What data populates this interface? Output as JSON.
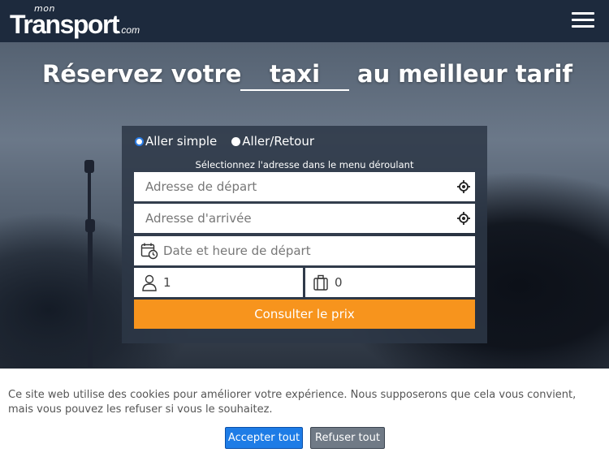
{
  "header": {
    "logo_mon": "mon",
    "logo_main": "Transport",
    "logo_com": ".com",
    "menu_icon": "hamburger-menu-icon"
  },
  "hero": {
    "headline_pre": "Réservez votre",
    "headline_word": "taxi",
    "headline_post": "au meilleur tarif"
  },
  "form": {
    "trip_types": [
      {
        "label": "Aller simple",
        "selected": true
      },
      {
        "label": "Aller/Retour",
        "selected": false
      }
    ],
    "hint": "Sélectionnez l'adresse dans le menu déroulant",
    "departure_placeholder": "Adresse de départ",
    "arrival_placeholder": "Adresse d'arrivée",
    "date_placeholder": "Date et heure de départ",
    "passengers": "1",
    "luggage": "0",
    "submit_label": "Consulter le prix",
    "location_icon": "crosshair-location-icon",
    "calendar_icon": "calendar-clock-icon",
    "passenger_icon": "person-icon",
    "luggage_icon": "suitcase-icon",
    "submit_color": "#f7941d"
  },
  "cookie": {
    "text": "Ce site web utilise des cookies pour améliorer votre expérience. Nous supposerons que cela vous convient, mais vous pouvez les refuser si vous le souhaitez.",
    "accept_label": "Accepter tout",
    "refuse_label": "Refuser tout",
    "accept_color": "#1e7ce6"
  }
}
